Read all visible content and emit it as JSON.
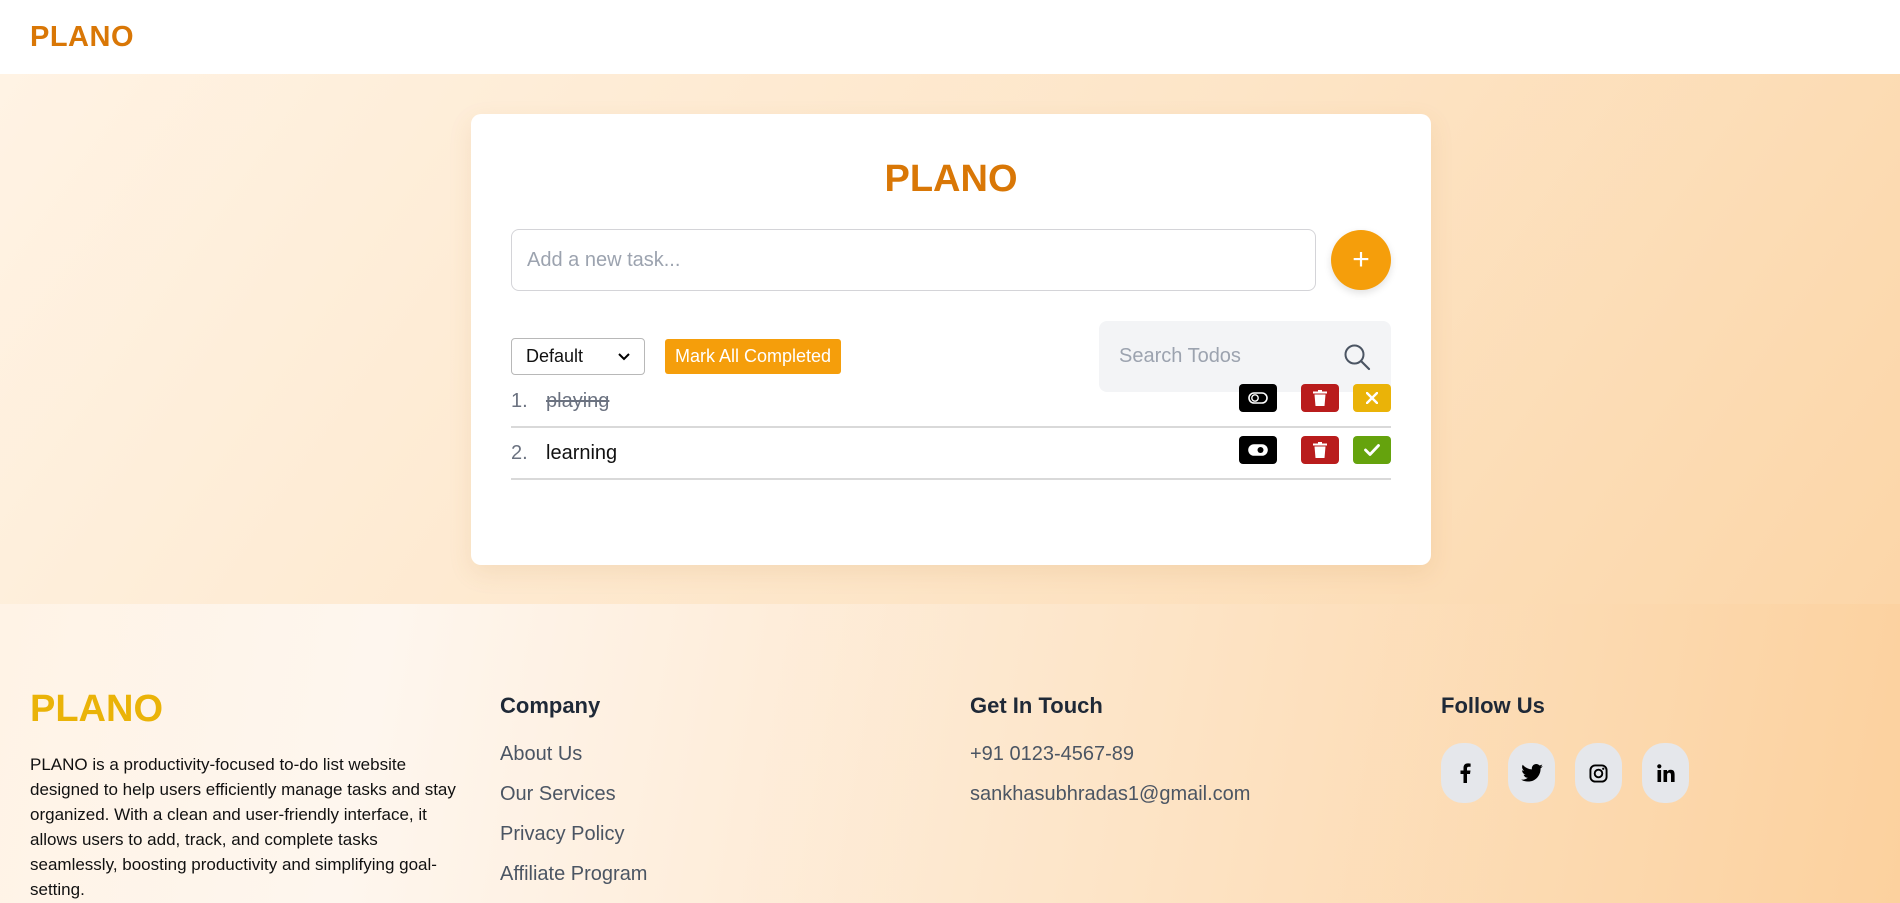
{
  "header": {
    "brand": "PLANO"
  },
  "card": {
    "title": "PLANO",
    "task_input": {
      "placeholder": "Add a new task...",
      "value": ""
    },
    "add_button_label": "+",
    "sort": {
      "selected": "Default"
    },
    "mark_all_label": "Mark All Completed",
    "search": {
      "placeholder": "Search Todos"
    },
    "todos": [
      {
        "number": "1.",
        "text": "playing",
        "completed": true
      },
      {
        "number": "2.",
        "text": "learning",
        "completed": false
      }
    ]
  },
  "footer": {
    "brand": "PLANO",
    "description": "PLANO is a productivity-focused to-do list website designed to help users efficiently manage tasks and stay organized. With a clean and user-friendly interface, it allows users to add, track, and complete tasks seamlessly, boosting productivity and simplifying goal-setting.",
    "company": {
      "heading": "Company",
      "links": [
        "About Us",
        "Our Services",
        "Privacy Policy",
        "Affiliate Program"
      ]
    },
    "contact": {
      "heading": "Get In Touch",
      "phone": "+91 0123-4567-89",
      "email": "sankhasubhradas1@gmail.com"
    },
    "follow": {
      "heading": "Follow Us",
      "icons": [
        "facebook-icon",
        "twitter-icon",
        "instagram-icon",
        "linkedin-icon"
      ]
    }
  },
  "colors": {
    "brand_orange": "#d97706",
    "accent_amber": "#f59e0b",
    "footer_brand": "#eab308",
    "delete_red": "#b91c1c",
    "complete_green": "#65a30d"
  }
}
